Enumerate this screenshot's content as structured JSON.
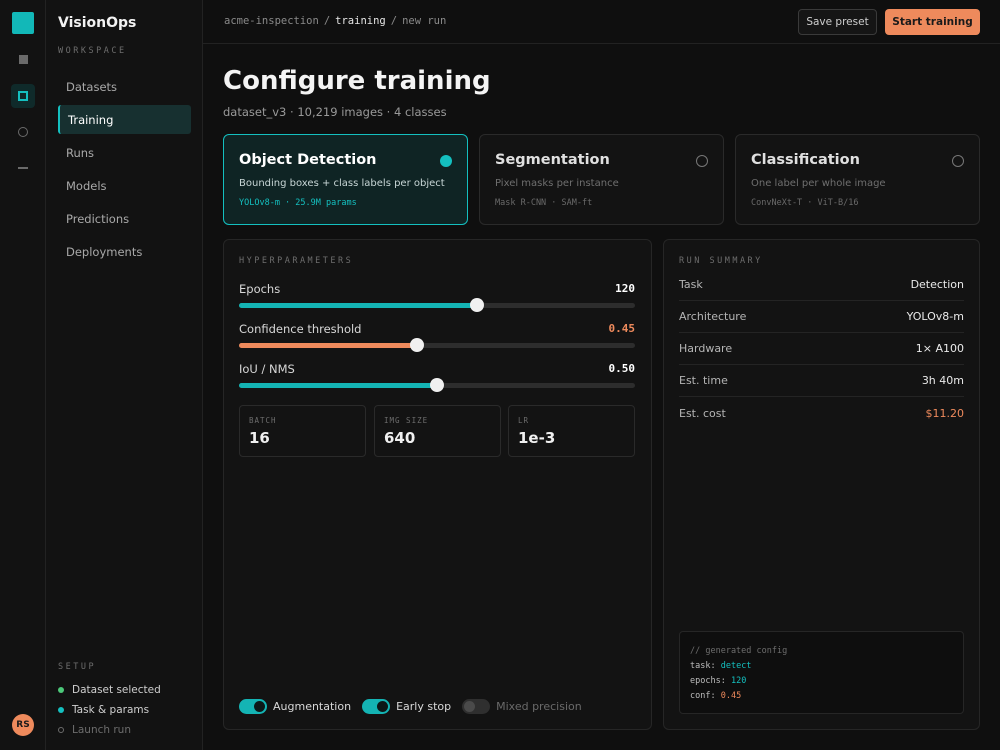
{
  "app": {
    "brand": "VisionOps",
    "avatar_initials": "RS"
  },
  "rail": {
    "icons": [
      "square-icon",
      "square-outline-icon",
      "circle-icon",
      "dash-icon"
    ]
  },
  "sidebar": {
    "workspace_label": "WORKSPACE",
    "items": [
      {
        "label": "Datasets",
        "active": false
      },
      {
        "label": "Training",
        "active": true
      },
      {
        "label": "Runs",
        "active": false
      },
      {
        "label": "Models",
        "active": false
      },
      {
        "label": "Predictions",
        "active": false
      },
      {
        "label": "Deployments",
        "active": false
      }
    ],
    "setup_label": "SETUP",
    "setup_steps": [
      {
        "label": "Dataset selected",
        "state": "done"
      },
      {
        "label": "Task & params",
        "state": "current"
      },
      {
        "label": "Launch run",
        "state": "pending"
      }
    ]
  },
  "topbar": {
    "breadcrumb": [
      "acme-inspection",
      "training",
      "new run"
    ],
    "save_label": "Save preset",
    "start_label": "Start training"
  },
  "page": {
    "title": "Configure training",
    "subtitle": "dataset_v3 · 10,219 images · 4 classes"
  },
  "tasks": [
    {
      "title": "Object Detection",
      "desc": "Bounding boxes + class labels per object",
      "models": "YOLOv8-m · 25.9M params",
      "selected": true
    },
    {
      "title": "Segmentation",
      "desc": "Pixel masks per instance",
      "models": "Mask R-CNN · SAM-ft",
      "selected": false
    },
    {
      "title": "Classification",
      "desc": "One label per whole image",
      "models": "ConvNeXt-T · ViT-B/16",
      "selected": false
    }
  ],
  "hyperparams": {
    "label": "HYPERPARAMETERS",
    "sliders": [
      {
        "label": "Epochs",
        "value": "120",
        "fraction": 0.6
      },
      {
        "label": "Confidence threshold",
        "value": "0.45",
        "fraction": 0.45
      },
      {
        "label": "IoU / NMS",
        "value": "0.50",
        "fraction": 0.5
      }
    ],
    "fields": [
      {
        "label": "BATCH",
        "value": "16"
      },
      {
        "label": "IMG SIZE",
        "value": "640"
      },
      {
        "label": "LR",
        "value": "1e-3"
      }
    ],
    "toggles": [
      {
        "label": "Augmentation",
        "on": true
      },
      {
        "label": "Early stop",
        "on": true
      },
      {
        "label": "Mixed precision",
        "on": false
      }
    ]
  },
  "summary": {
    "label": "RUN SUMMARY",
    "rows": [
      {
        "key": "Task",
        "value": "Detection"
      },
      {
        "key": "Architecture",
        "value": "YOLOv8-m"
      },
      {
        "key": "Hardware",
        "value": "1× A100"
      },
      {
        "key": "Est. time",
        "value": "3h 40m"
      },
      {
        "key": "Est. cost",
        "value": "$11.20"
      }
    ],
    "code": {
      "comment": "// generated config",
      "lines": [
        {
          "key": "task:",
          "value": "detect"
        },
        {
          "key": "epochs:",
          "value": "120"
        },
        {
          "key": "conf:",
          "value": "0.45"
        }
      ]
    }
  },
  "colors": {
    "accent": "#14c0c0",
    "brand_orange": "#ee8a5c",
    "success": "#4cc97a",
    "background": "#0f0f0f"
  }
}
